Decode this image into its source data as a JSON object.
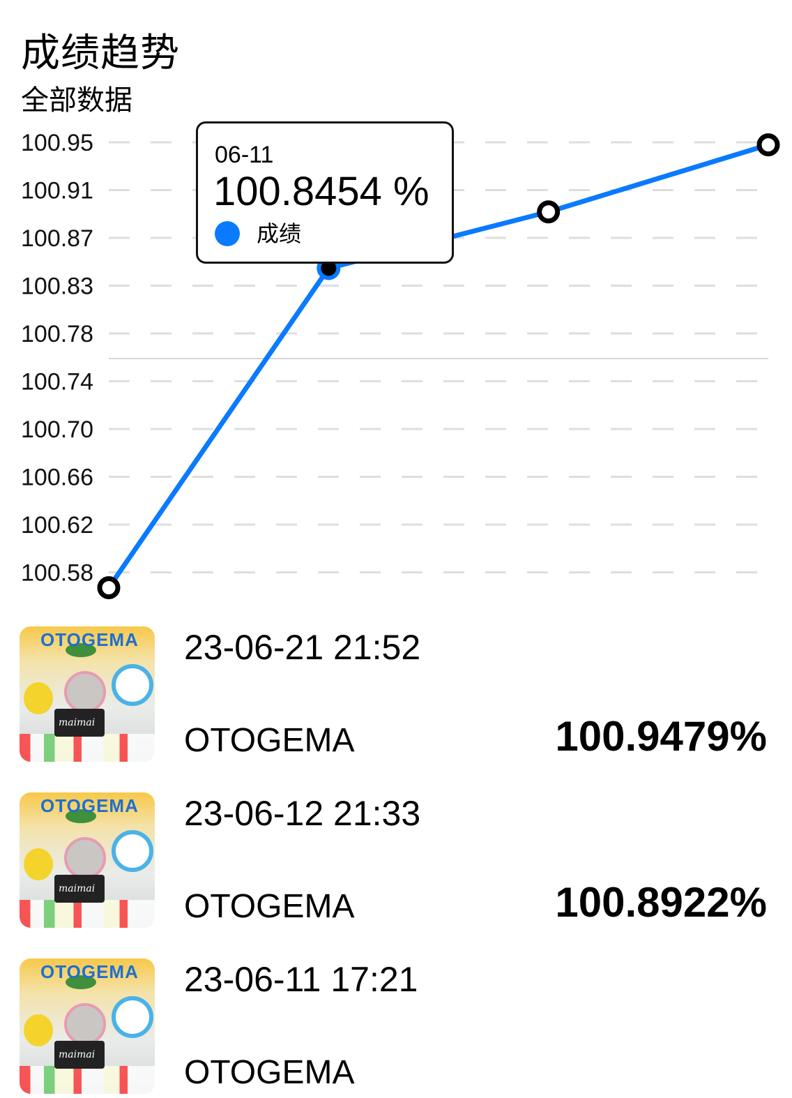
{
  "header": {
    "title": "成绩趋势",
    "subtitle": "全部数据"
  },
  "chart_data": {
    "type": "line",
    "title": "成绩趋势",
    "subtitle": "全部数据",
    "y_ticks": [
      "100.95",
      "100.91",
      "100.87",
      "100.83",
      "100.78",
      "100.74",
      "100.70",
      "100.66",
      "100.62",
      "100.58"
    ],
    "ylim": [
      100.58,
      100.95
    ],
    "grid": true,
    "series": [
      {
        "name": "成绩",
        "color": "#0a7aff",
        "values": [
          100.58,
          100.8454,
          100.8922,
          100.9479
        ]
      }
    ],
    "x": [
      "",
      "06-11",
      "06-12",
      "06-21"
    ],
    "tooltip": {
      "date": "06-11",
      "value": "100.8454 %",
      "series": "成绩",
      "index": 1
    }
  },
  "records": [
    {
      "datetime": "23-06-21 21:52",
      "song": "OTOGEMA",
      "score": "100.9479%",
      "thumb_logo": "OTOGEMA",
      "thumb_sub": "maimai"
    },
    {
      "datetime": "23-06-12 21:33",
      "song": "OTOGEMA",
      "score": "100.8922%",
      "thumb_logo": "OTOGEMA",
      "thumb_sub": "maimai"
    },
    {
      "datetime": "23-06-11 17:21",
      "song": "OTOGEMA",
      "score": "",
      "thumb_logo": "OTOGEMA",
      "thumb_sub": "maimai"
    }
  ]
}
